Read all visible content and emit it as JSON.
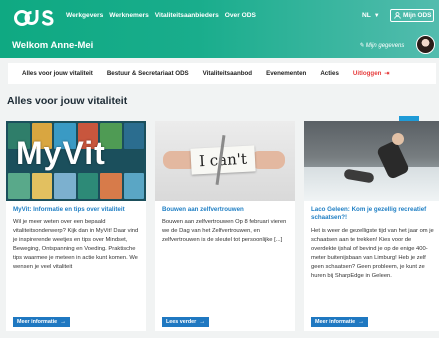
{
  "header": {
    "nav": [
      "Werkgevers",
      "Werknemers",
      "Vitaliteitsaanbieders",
      "Over ODS"
    ],
    "language": "NL",
    "my_ods_label": "Mijn ODS",
    "welcome": "Welkom Anne-Mei",
    "my_details_label": "Mijn gegevens"
  },
  "subnav": {
    "items": [
      "Alles voor jouw vitaliteit",
      "Bestuur & Secretariaat ODS",
      "Vitaliteitsaanbod",
      "Evenementen",
      "Acties"
    ],
    "logout_label": "Uitloggen"
  },
  "section": {
    "title": "Alles voor jouw vitaliteit",
    "badge": "1"
  },
  "cards": [
    {
      "image_label": "MyVit",
      "title": "MyVit: Informatie en tips over vitaliteit",
      "text": "Wil je meer weten over een bepaald vitaliteitsonderwerp? Kijk dan in MyVit! Daar vind je inspirerende weetjes en tips over Mindset, Beweging, Ontspanning en Voeding. Praktische tips waarmee je meteen in actie kunt komen. We wensen je veel vitaliteit",
      "button": "Meer informatie"
    },
    {
      "image_label": "I can't",
      "title": "Bouwen aan zelfvertrouwen",
      "text": "Bouwen aan zelfvertrouwen Op 8 februari vieren we de Dag van het Zelfvertrouwen, en zelfvertrouwen is de sleutel tot persoonlijke [...]",
      "button": "Lees verder"
    },
    {
      "title": "Laco Geleen: Kom je gezellig recreatief schaatsen?!",
      "text": "Het is weer de gezelligste tijd van het jaar om je schaatsen aan te trekken! Kies voor de overdekte ijshal of bevind je op de enige 400-meter buitenijsbaan van Limburg! Heb je zelf geen schaatsen? Geen probleem, je kunt ze huren bij SharpEdge in Geleen.",
      "button": "Meer informatie"
    }
  ],
  "colors": {
    "header_start": "#0fa982",
    "header_end": "#53bcae",
    "link_blue": "#1f7fc4",
    "button_blue": "#1f78c1",
    "badge_blue": "#1f9bd7",
    "logout_red": "#e63c3c"
  }
}
